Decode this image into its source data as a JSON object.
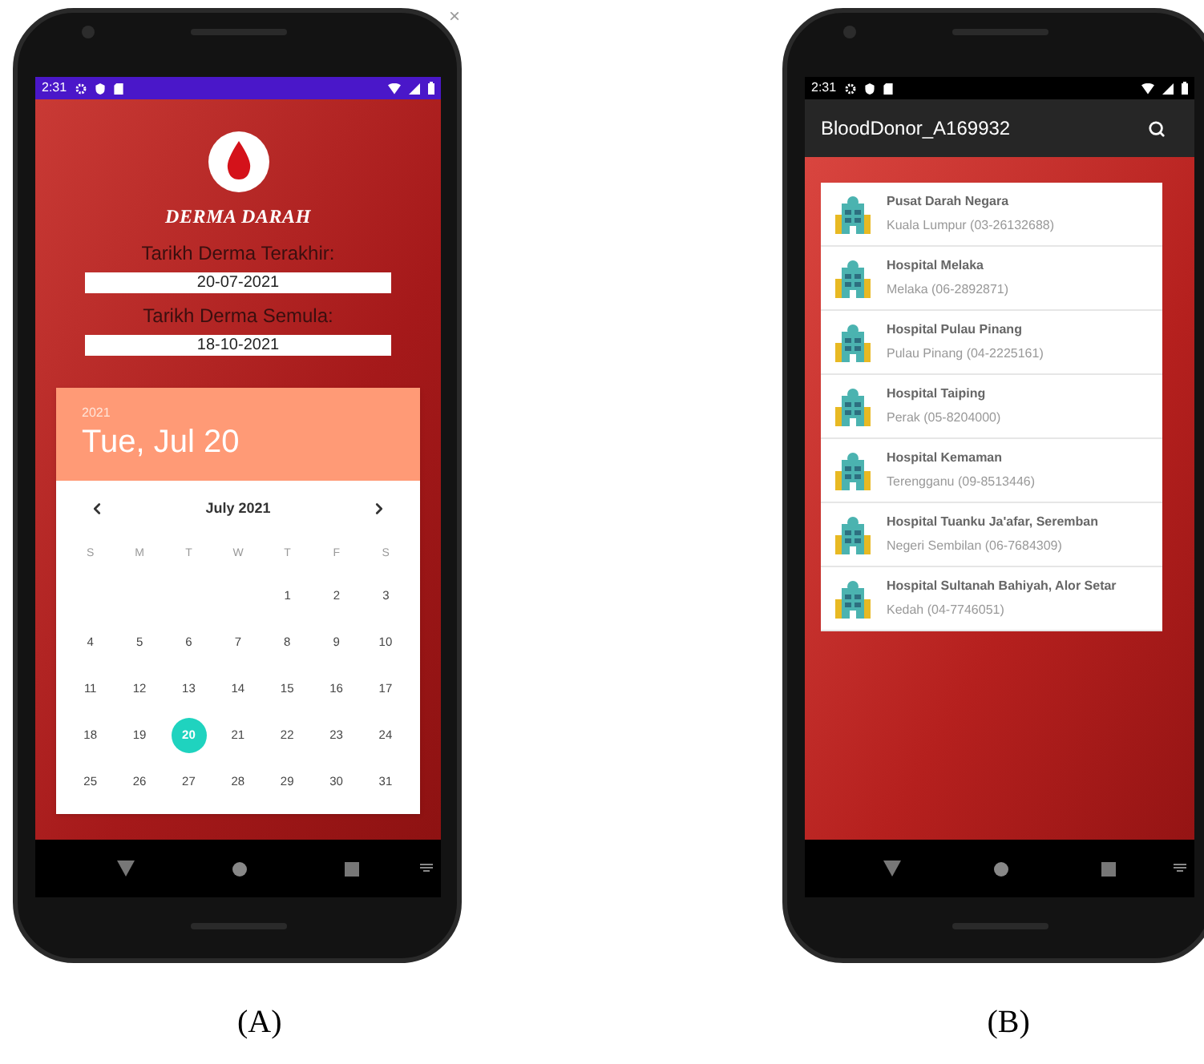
{
  "panel_a": {
    "close": "×",
    "status_bar": {
      "time": "2:31"
    },
    "logo_text": "DERMA DARAH",
    "fields": [
      {
        "label": "Tarikh Derma Terakhir:",
        "value": "20-07-2021"
      },
      {
        "label": "Tarikh Derma Semula:",
        "value": "18-10-2021"
      }
    ],
    "date_picker": {
      "year": "2021",
      "date": "Tue, Jul 20",
      "month": "July 2021",
      "weekdays": [
        "S",
        "M",
        "T",
        "W",
        "T",
        "F",
        "S"
      ],
      "weeks": [
        [
          {
            "day": "1",
            "selected": false
          },
          {
            "day": "2",
            "selected": false
          },
          {
            "day": "3",
            "selected": false
          }
        ],
        [
          {
            "day": "4",
            "selected": false
          },
          {
            "day": "5",
            "selected": false
          },
          {
            "day": "6",
            "selected": false
          },
          {
            "day": "7",
            "selected": false
          },
          {
            "day": "8",
            "selected": false
          },
          {
            "day": "9",
            "selected": false
          },
          {
            "day": "10",
            "selected": false
          }
        ],
        [
          {
            "day": "11",
            "selected": false
          },
          {
            "day": "12",
            "selected": false
          },
          {
            "day": "13",
            "selected": false
          },
          {
            "day": "14",
            "selected": false
          },
          {
            "day": "15",
            "selected": false
          },
          {
            "day": "16",
            "selected": false
          },
          {
            "day": "17",
            "selected": false
          }
        ],
        [
          {
            "day": "18",
            "selected": false
          },
          {
            "day": "19",
            "selected": false
          },
          {
            "day": "20",
            "selected": true
          },
          {
            "day": "21",
            "selected": false
          },
          {
            "day": "22",
            "selected": false
          },
          {
            "day": "23",
            "selected": false
          },
          {
            "day": "24",
            "selected": false
          }
        ],
        [
          {
            "day": "25",
            "selected": false
          },
          {
            "day": "26",
            "selected": false
          },
          {
            "day": "27",
            "selected": false
          },
          {
            "day": "28",
            "selected": false
          },
          {
            "day": "29",
            "selected": false
          },
          {
            "day": "30",
            "selected": false
          },
          {
            "day": "31",
            "selected": false
          }
        ]
      ]
    },
    "caption": "(A)"
  },
  "panel_b": {
    "status_bar": {
      "time": "2:31"
    },
    "app_bar": {
      "title": "BloodDonor_A169932"
    },
    "hospitals": [
      {
        "name": "Pusat Darah Negara",
        "location": "Kuala Lumpur (03-26132688)"
      },
      {
        "name": "Hospital Melaka",
        "location": "Melaka (06-2892871)"
      },
      {
        "name": "Hospital Pulau Pinang",
        "location": "Pulau Pinang (04-2225161)"
      },
      {
        "name": "Hospital Taiping",
        "location": "Perak (05-8204000)"
      },
      {
        "name": "Hospital Kemaman",
        "location": "Terengganu (09-8513446)"
      },
      {
        "name": "Hospital Tuanku Ja'afar, Seremban",
        "location": "Negeri Sembilan (06-7684309)"
      },
      {
        "name": "Hospital Sultanah Bahiyah, Alor Setar",
        "location": "Kedah (04-7746051)"
      }
    ],
    "caption": "(B)"
  }
}
